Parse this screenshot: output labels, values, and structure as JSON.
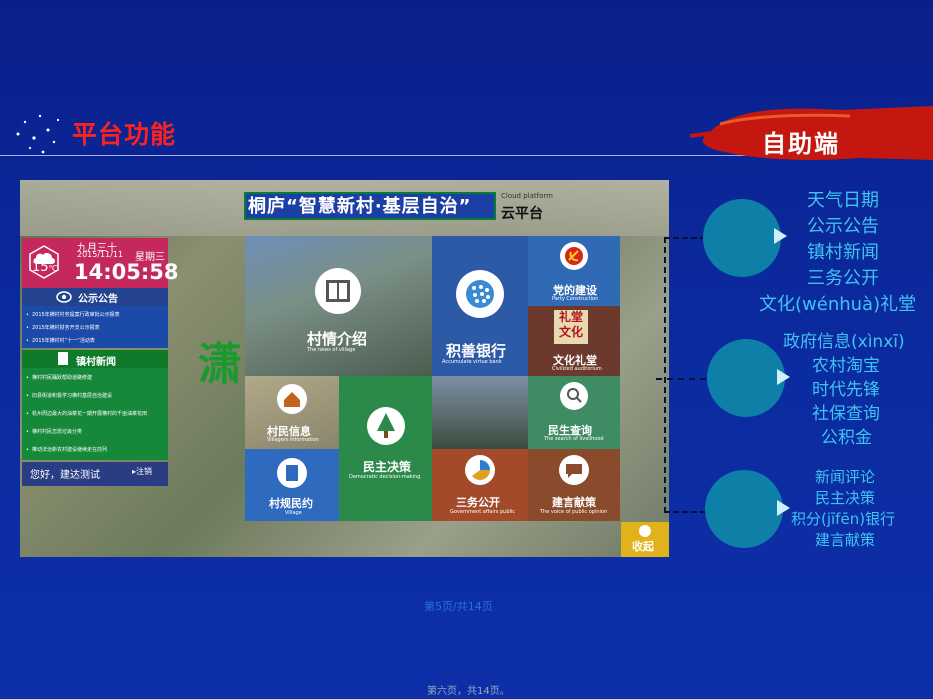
{
  "slide": {
    "title": "平台功能",
    "banner": "自助端"
  },
  "screen": {
    "title_main": "桐庐“智慧新村·基层自治”",
    "cloud_en": "Cloud platform",
    "cloud_cn": "云平台",
    "left_glyph": "潇",
    "weather": {
      "temperature": "15",
      "temperature_unit": "℃",
      "lunar": "九月三十",
      "weekday": "星期三",
      "date": "2015/11/11",
      "time": "14:05:58"
    },
    "notice": {
      "title": "公示公告",
      "items": [
        "2015年横村村务提案行政审批公示报表",
        "2015年横村财务开支公示报表",
        "2015年横村村“十一”活动表"
      ]
    },
    "news": {
      "title": "镇村新闻",
      "items": [
        "横村村民踊跃帮助道路修建",
        "旧县街道积极学习横村基层自治建设",
        "杭州周边最大的油菜花一期开展横村的千亩油菜花田",
        "横村村民志愿垃圾分类",
        "推动法治新农村建设继续走在前列"
      ]
    },
    "login": {
      "greeting": "您好，建达测试",
      "logout": "注销"
    },
    "tiles": {
      "village": {
        "cn": "村情介绍",
        "en": "The news of village"
      },
      "bank": {
        "cn": "积善银行",
        "en": "Accumulate virtue bank"
      },
      "party": {
        "cn": "党的建设",
        "en": "Party Construction"
      },
      "culture": {
        "cn": "文化礼堂",
        "en": "Civilized auditorium",
        "sign": "礼堂文化"
      },
      "villager": {
        "cn": "村民信息",
        "en": "Villagers information"
      },
      "decision": {
        "cn": "民主决策",
        "en": "Democratic decision-making"
      },
      "life": {
        "cn": "民生查询",
        "en": "The search of livelihood"
      },
      "rules": {
        "cn": "村规民约",
        "en": "Village"
      },
      "affairs": {
        "cn": "三务公开",
        "en": "Government affairs public"
      },
      "advice": {
        "cn": "建言献策",
        "en": "The voice of public opinion"
      }
    },
    "collapse": "收起"
  },
  "groups": [
    {
      "items": [
        "天气日期",
        "公示公告",
        "镇村新闻",
        "三务公开",
        "文化(wénhuà)礼堂"
      ]
    },
    {
      "items": [
        "政府信息(xìnxī)",
        "农村淘宝",
        "时代先锋",
        "社保查询",
        "公积金"
      ]
    },
    {
      "items": [
        "新闻评论",
        "民主决策",
        "积分(jīfēn)银行",
        "建言献策"
      ]
    }
  ],
  "footer": {
    "page_blue": "第5页/共14页",
    "page_bottom": "第六页，共14页。"
  }
}
